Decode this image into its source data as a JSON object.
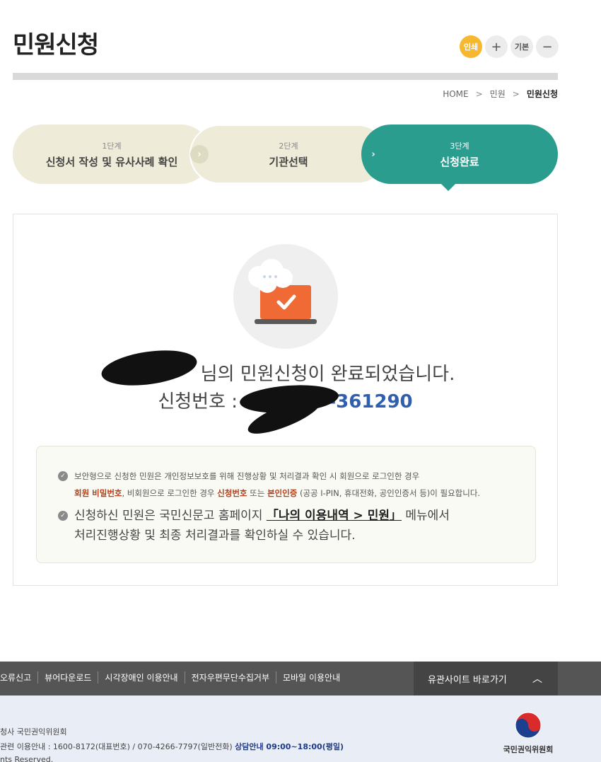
{
  "page": {
    "title": "민원신청"
  },
  "tools": {
    "print": "인쇄",
    "zoom_in": "+",
    "default": "기본",
    "zoom_out": "−"
  },
  "breadcrumb": [
    "HOME",
    "민원",
    "민원신청"
  ],
  "steps": [
    {
      "num": "1단계",
      "name": "신청서 작성 및 유사사례 확인"
    },
    {
      "num": "2단계",
      "name": "기관선택"
    },
    {
      "num": "3단계",
      "name": "신청완료"
    }
  ],
  "result": {
    "message_suffix": "님의 민원신청이 완료되었습니다.",
    "app_no_label": "신청번호 : ",
    "app_no_visible": "-361290"
  },
  "notice": {
    "line1a": "보안형으로 신청한 민원은 개인정보보호를 위해 진행상황 및 처리결과 확인 시 회원으로 로그인한 경우",
    "line1b_hl1": "회원 비밀번호",
    "line1b_t1": ", 비회원으로 로그인한 경우 ",
    "line1b_hl2": "신청번호",
    "line1b_t2": " 또는 ",
    "line1b_hl3": "본인인증",
    "line1b_t3": " (공공 I-PIN, 휴대전화, 공인인증서 등)이 필요합니다.",
    "line2a": "신청하신 민원은 국민신문고 홈페이지 ",
    "line2_link": "「나의 이용내역 > 민원」",
    "line2b": " 메뉴에서",
    "line2c": "처리진행상황 및 최종 처리결과를 확인하실 수 있습니다."
  },
  "footer": {
    "links": [
      "오류신고",
      "뷰어다운로드",
      "시각장애인 이용안내",
      "전자우편무단수집거부",
      "모바일 이용안내"
    ],
    "related": "유관사이트 바로가기",
    "addr": "청사 국민권익위원회",
    "contact_a": "관련 이용안내 : 1600-8172(대표번호) / 070-4266-7797(일반전화) ",
    "contact_b": "상담안내 09:00~18:00(평일)",
    "rights": "nts Reserved.",
    "org_name": "국민권익위원회"
  },
  "colors": {
    "primary": "#2a9d8f",
    "step_inactive": "#eeebd9",
    "highlight": "#b3401a",
    "app_no": "#2f5fae"
  }
}
